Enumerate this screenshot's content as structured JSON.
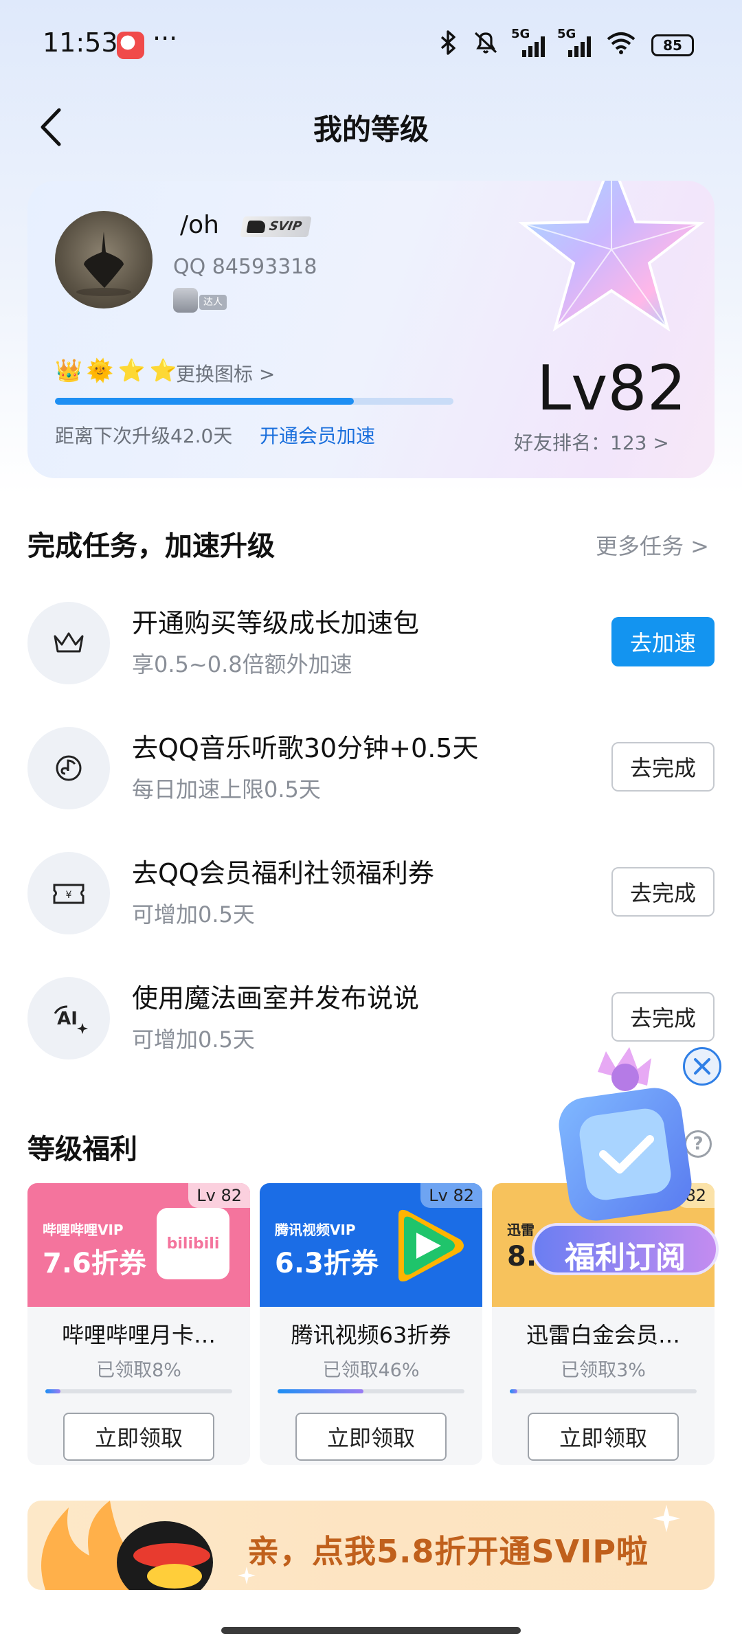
{
  "status_bar": {
    "time": "11:53",
    "dots": "···",
    "network_1": "5G",
    "network_2": "5G",
    "battery": "85"
  },
  "header": {
    "title": "我的等级"
  },
  "profile": {
    "nickname": "/oh",
    "svip_badge": "SVIP",
    "qq_label": "QQ 84593318",
    "talent_badge": "达人",
    "change_icon": "更换图标 >",
    "level_progress": 0.75,
    "next_level_text": "距离下次升级42.0天",
    "speedup_link": "开通会员加速",
    "level": "Lv82",
    "friend_rank": "好友排名：123 >"
  },
  "tasks_section": {
    "title": "完成任务，加速升级",
    "more": "更多任务 >",
    "items": [
      {
        "icon": "crown-icon",
        "title": "开通购买等级成长加速包",
        "subtitle": "享0.5~0.8倍额外加速",
        "button": "去加速",
        "primary": true
      },
      {
        "icon": "music-note-icon",
        "title": "去QQ音乐听歌30分钟+0.5天",
        "subtitle": "每日加速上限0.5天",
        "button": "去完成",
        "primary": false
      },
      {
        "icon": "coupon-icon",
        "title": "去QQ会员福利社领福利券",
        "subtitle": "可增加0.5天",
        "button": "去完成",
        "primary": false
      },
      {
        "icon": "ai-sparkle-icon",
        "title": "使用魔法画室并发布说说",
        "subtitle": "可增加0.5天",
        "button": "去完成",
        "primary": false
      }
    ]
  },
  "benefits_section": {
    "title": "等级福利",
    "items": [
      {
        "brand": "哔哩哔哩VIP",
        "discount": "7.6折券",
        "level": "Lv 82",
        "name": "哔哩哔哩月卡…",
        "claimed": "已领取8%",
        "progress": 0.08,
        "button": "立即领取",
        "color": "#f4749d",
        "logo_text": "bilibili"
      },
      {
        "brand": "腾讯视频VIP",
        "discount": "6.3折券",
        "level": "Lv 82",
        "name": "腾讯视频63折券",
        "claimed": "已领取46%",
        "progress": 0.46,
        "button": "立即领取",
        "color": "#1b6de6"
      },
      {
        "brand": "迅雷",
        "discount": "8.",
        "level": "82",
        "name": "迅雷白金会员…",
        "claimed": "已领取3%",
        "progress": 0.03,
        "button": "立即领取",
        "color": "#f7c25c"
      }
    ]
  },
  "float_promo": {
    "label": "福利订阅"
  },
  "svip_banner": {
    "text": "亲，点我5.8折开通SVIP啦"
  }
}
